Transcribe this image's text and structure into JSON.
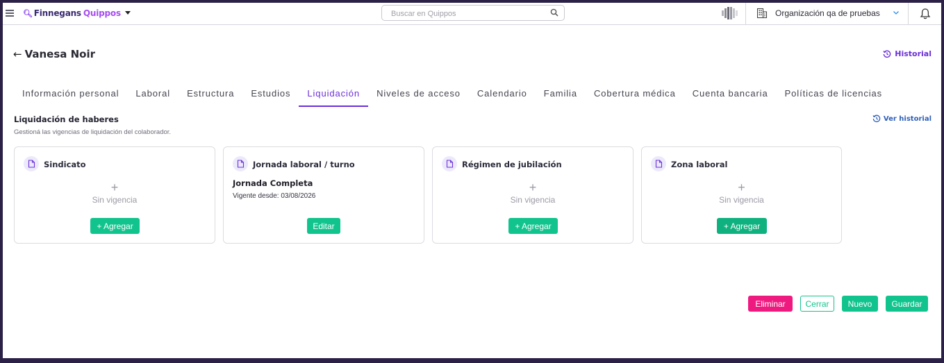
{
  "topbar": {
    "brand_part1": "Finnegans",
    "brand_part2": "Quippos",
    "search_placeholder": "Buscar en Quippos",
    "organization": "Organización qa de pruebas"
  },
  "header": {
    "back_arrow": "←",
    "person_name": "Vanesa Noir",
    "historial_label": "Historial"
  },
  "tabs": [
    {
      "label": "Información personal",
      "active": false
    },
    {
      "label": "Laboral",
      "active": false
    },
    {
      "label": "Estructura",
      "active": false
    },
    {
      "label": "Estudios",
      "active": false
    },
    {
      "label": "Liquidación",
      "active": true
    },
    {
      "label": "Niveles de acceso",
      "active": false
    },
    {
      "label": "Calendario",
      "active": false
    },
    {
      "label": "Familia",
      "active": false
    },
    {
      "label": "Cobertura médica",
      "active": false
    },
    {
      "label": "Cuenta bancaria",
      "active": false
    },
    {
      "label": "Políticas de licencias",
      "active": false
    }
  ],
  "section": {
    "title": "Liquidación de haberes",
    "subtitle": "Gestioná las vigencias de liquidación del colaborador.",
    "ver_historial": "Ver historial"
  },
  "cards": [
    {
      "title": "Sindicato",
      "plus": "+",
      "empty_text": "Sin vigencia",
      "button": "+ Agregar"
    },
    {
      "title": "Jornada laboral / turno",
      "value": "Jornada Completa",
      "since": "Vigente desde: 03/08/2026",
      "button": "Editar"
    },
    {
      "title": "Régimen de jubilación",
      "plus": "+",
      "empty_text": "Sin vigencia",
      "button": "+ Agregar"
    },
    {
      "title": "Zona laboral",
      "plus": "+",
      "empty_text": "Sin vigencia",
      "button": "+ Agregar"
    }
  ],
  "actions": {
    "eliminar": "Eliminar",
    "cerrar": "Cerrar",
    "nuevo": "Nuevo",
    "guardar": "Guardar"
  },
  "colors": {
    "accent": "#6a2fd8",
    "primary_green": "#11c48d",
    "danger_pink": "#ef1a80",
    "frame": "#2b2146"
  }
}
